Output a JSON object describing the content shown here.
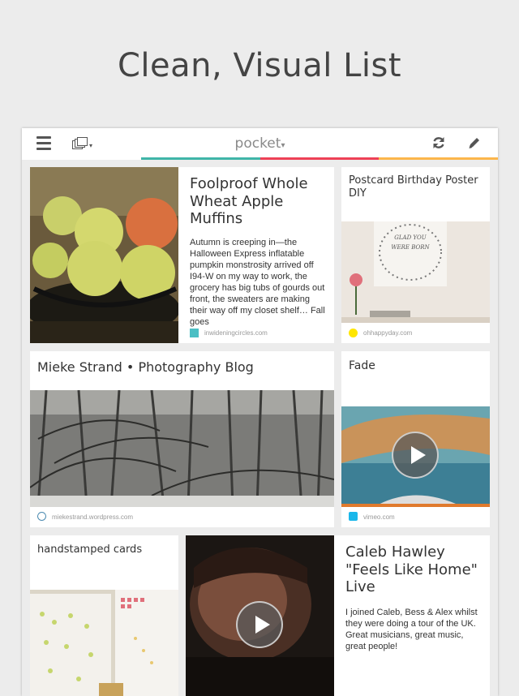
{
  "headline": "Clean, Visual List",
  "toolbar": {
    "logo": "pocket",
    "logo_caret": "▾",
    "list_caret": "▾",
    "icons": [
      "menu-icon",
      "list-view-icon",
      "refresh-icon",
      "edit-icon"
    ],
    "colors": [
      "#3fb5a8",
      "#ee4056",
      "#fcb64b"
    ]
  },
  "cards": {
    "muffins": {
      "title": "Foolproof Whole Wheat Apple Muffins",
      "excerpt": "Autumn is creeping in—the Halloween Express inflatable pumpkin monstrosity arrived off I94-W on my way to work, the grocery has big tubs of gourds out front, the sweaters are making their way off my closet shelf… Fall goes",
      "source": "inwideningcircles.com",
      "source_color": "#4bbfc4"
    },
    "postcard": {
      "title": "Postcard Birthday Poster DIY",
      "poster_text": "GLAD YOU WERE BORN",
      "source": "ohhappyday.com",
      "source_color": "#ffe600"
    },
    "mieke": {
      "title": "Mieke Strand • Photography Blog",
      "source": "miekestrand.wordpress.com"
    },
    "fade": {
      "title": "Fade",
      "source": "vimeo.com"
    },
    "handstamped": {
      "title": "handstamped cards"
    },
    "caleb": {
      "title": "Caleb Hawley \"Feels Like Home\" Live",
      "excerpt": "I joined Caleb, Bess & Alex whilst they were doing a tour of the UK. Great musicians, great music, great people!"
    }
  }
}
